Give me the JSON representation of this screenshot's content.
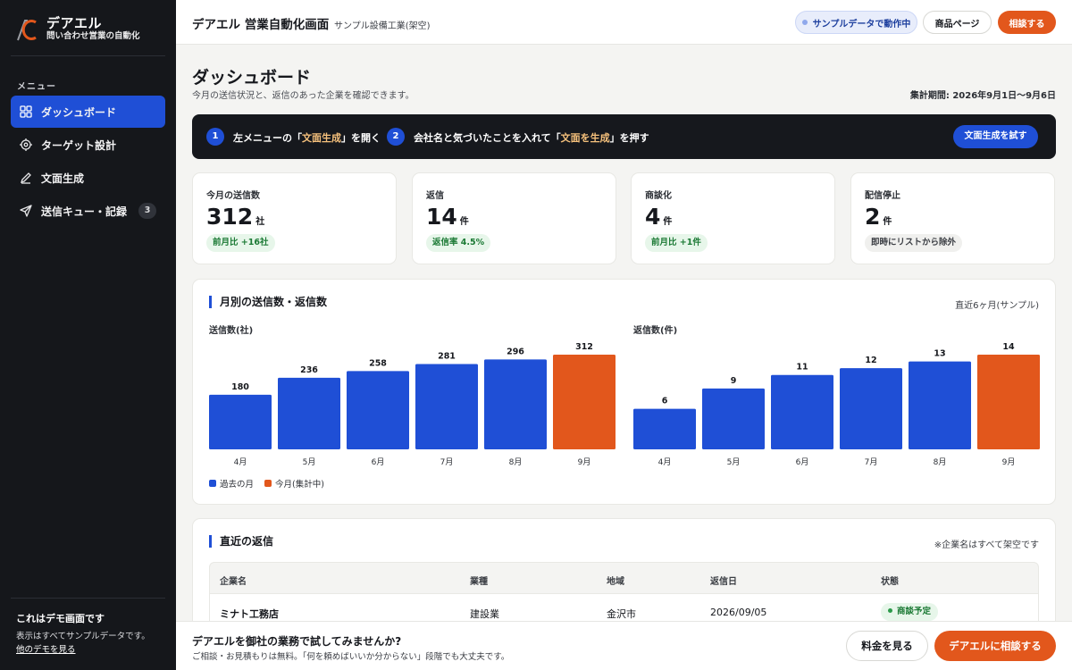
{
  "brand": {
    "name": "デアエル",
    "tagline": "問い合わせ営業の自動化"
  },
  "sidebar": {
    "menu_label": "メニュー",
    "items": [
      {
        "label": "ダッシュボード",
        "icon": "grid-icon",
        "active": true
      },
      {
        "label": "ターゲット設計",
        "icon": "target-icon"
      },
      {
        "label": "文面生成",
        "icon": "pen-icon"
      },
      {
        "label": "送信キュー・記録",
        "icon": "send-icon",
        "badge": "3"
      }
    ],
    "demo": {
      "title": "これはデモ画面です",
      "text": "表示はすべてサンプルデータです。",
      "link": "他のデモを見る"
    }
  },
  "topbar": {
    "title": "デアエル 営業自動化画面",
    "subtitle": "サンプル設備工業(架空)",
    "status": "サンプルデータで動作中",
    "product": "商品ページ",
    "consult": "相談する"
  },
  "page": {
    "title": "ダッシュボード",
    "description": "今月の送信状況と、返信のあった企業を確認できます。",
    "period": "集計期間: 2026年9月1日〜9月6日"
  },
  "guide": {
    "step1_num": "1",
    "step1_pre": "左メニューの「",
    "step1_hl": "文面生成",
    "step1_post": "」を開く",
    "step2_num": "2",
    "step2_pre": "会社名と気づいたことを入れて「",
    "step2_hl": "文面を生成",
    "step2_post": "」を押す",
    "button": "文面生成を試す"
  },
  "kpis": [
    {
      "label": "今月の送信数",
      "value": "312",
      "unit": "社",
      "tag": "前月比 +16社",
      "tone": "green"
    },
    {
      "label": "返信",
      "value": "14",
      "unit": "件",
      "tag": "返信率 4.5%",
      "tone": "green"
    },
    {
      "label": "商談化",
      "value": "4",
      "unit": "件",
      "tag": "前月比 +1件",
      "tone": "green"
    },
    {
      "label": "配信停止",
      "value": "2",
      "unit": "件",
      "tag": "即時にリストから除外",
      "tone": "gray"
    }
  ],
  "chart_card": {
    "title": "月別の送信数・返信数",
    "note": "直近6ヶ月(サンプル)",
    "legend": [
      "過去の月",
      "今月(集計中)"
    ]
  },
  "colors": {
    "past": "#1f4fd6",
    "current": "#e2571c"
  },
  "chart_data": [
    {
      "type": "bar",
      "title": "送信数(社)",
      "categories": [
        "4月",
        "5月",
        "6月",
        "7月",
        "8月",
        "9月"
      ],
      "values": [
        180,
        236,
        258,
        281,
        296,
        312
      ],
      "ylim": [
        0,
        312
      ]
    },
    {
      "type": "bar",
      "title": "返信数(件)",
      "categories": [
        "4月",
        "5月",
        "6月",
        "7月",
        "8月",
        "9月"
      ],
      "values": [
        6,
        9,
        11,
        12,
        13,
        14
      ],
      "ylim": [
        0,
        14
      ]
    }
  ],
  "replies": {
    "title": "直近の返信",
    "note": "※企業名はすべて架空です",
    "columns": [
      "企業名",
      "業種",
      "地域",
      "返信日",
      "状態"
    ],
    "rows": [
      [
        "ミナト工務店",
        "建設業",
        "金沢市",
        "2026/09/05",
        "商談予定"
      ]
    ]
  },
  "cta": {
    "title": "デアエルを御社の業務で試してみませんか?",
    "text": "ご相談・お見積もりは無料。「何を頼めばいいか分からない」段階でも大丈夫です。",
    "price": "料金を見る",
    "consult": "デアエルに相談する"
  }
}
